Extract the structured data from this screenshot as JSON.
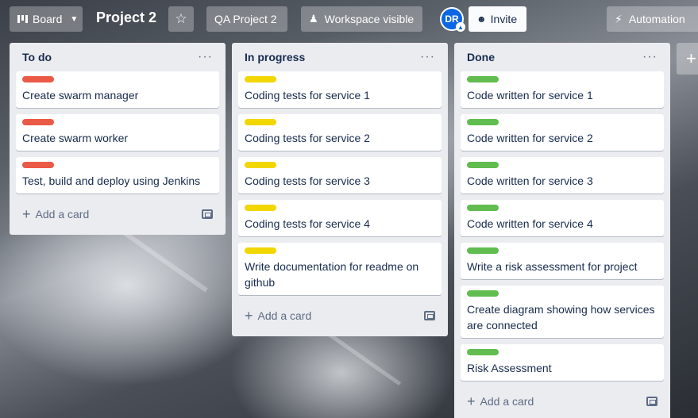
{
  "header": {
    "view_button": "Board",
    "board_title": "Project 2",
    "workspace_name": "QA Project 2",
    "visibility": "Workspace visible",
    "avatar_initials": "DR",
    "invite_label": "Invite",
    "automation_label": "Automation"
  },
  "colors": {
    "red": "#eb5a46",
    "yellow": "#f2d600",
    "green": "#61bd4f"
  },
  "lists": [
    {
      "title": "To do",
      "add_card": "Add a card",
      "cards": [
        {
          "label": "red",
          "text": "Create swarm manager"
        },
        {
          "label": "red",
          "text": "Create swarm worker"
        },
        {
          "label": "red",
          "text": "Test, build and deploy using Jenkins"
        }
      ]
    },
    {
      "title": "In progress",
      "add_card": "Add a card",
      "cards": [
        {
          "label": "yellow",
          "text": "Coding tests for service 1"
        },
        {
          "label": "yellow",
          "text": "Coding tests for service 2"
        },
        {
          "label": "yellow",
          "text": "Coding tests for service 3"
        },
        {
          "label": "yellow",
          "text": "Coding tests for service 4"
        },
        {
          "label": "yellow",
          "text": "Write documentation for readme on github"
        }
      ]
    },
    {
      "title": "Done",
      "add_card": "Add a card",
      "cards": [
        {
          "label": "green",
          "text": "Code written for service 1"
        },
        {
          "label": "green",
          "text": "Code written for service 2"
        },
        {
          "label": "green",
          "text": "Code written for service 3"
        },
        {
          "label": "green",
          "text": "Code written for service 4"
        },
        {
          "label": "green",
          "text": "Write a risk assessment for project"
        },
        {
          "label": "green",
          "text": "Create diagram showing how services are connected"
        },
        {
          "label": "green",
          "text": "Risk Assessment"
        }
      ]
    }
  ]
}
